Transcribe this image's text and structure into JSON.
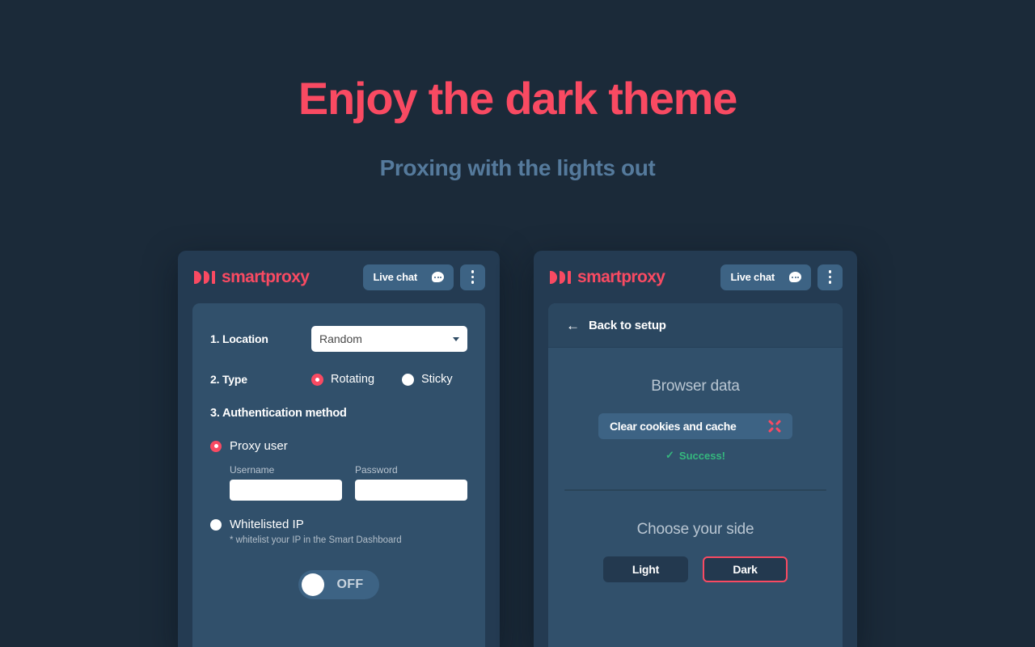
{
  "hero": {
    "title": "Enjoy the dark theme",
    "subtitle": "Proxing with the lights out"
  },
  "colors": {
    "background": "#1b2a39",
    "panel": "#243b52",
    "card": "#31506b",
    "accent": "#f94a62",
    "muted_blue": "#557a9c",
    "button_blue": "#3d6384",
    "success_green": "#35b87e"
  },
  "brand": {
    "name": "smartproxy",
    "logo_icon": "smartproxy-play-marks-icon"
  },
  "header": {
    "live_chat_label": "Live chat",
    "chat_icon": "chat-bubble-icon",
    "kebab_icon": "vertical-dots-icon"
  },
  "left_panel": {
    "location": {
      "label": "1. Location",
      "selected": "Random",
      "caret_icon": "chevron-down-icon"
    },
    "type": {
      "label": "2. Type",
      "options": [
        {
          "label": "Rotating",
          "selected": true
        },
        {
          "label": "Sticky",
          "selected": false
        }
      ]
    },
    "auth": {
      "title": "3. Authentication method",
      "proxy_user": {
        "label": "Proxy user",
        "selected": true,
        "username": {
          "label": "Username",
          "value": "",
          "placeholder": ""
        },
        "password": {
          "label": "Password",
          "value": "",
          "placeholder": ""
        }
      },
      "whitelisted_ip": {
        "label": "Whitelisted IP",
        "selected": false,
        "note": "* whitelist your IP in the Smart Dashboard"
      }
    },
    "toggle": {
      "state_label": "OFF",
      "on": false
    }
  },
  "right_panel": {
    "back": {
      "label": "Back to setup",
      "icon": "arrow-left-icon"
    },
    "browser_data": {
      "title": "Browser data",
      "clear_button_label": "Clear cookies and cache",
      "clear_button_icon": "collapse-arrows-icon",
      "status_text": "Success!",
      "status_icon": "check-icon"
    },
    "theme": {
      "title": "Choose your side",
      "options": [
        {
          "label": "Light",
          "active": false
        },
        {
          "label": "Dark",
          "active": true
        }
      ]
    }
  }
}
